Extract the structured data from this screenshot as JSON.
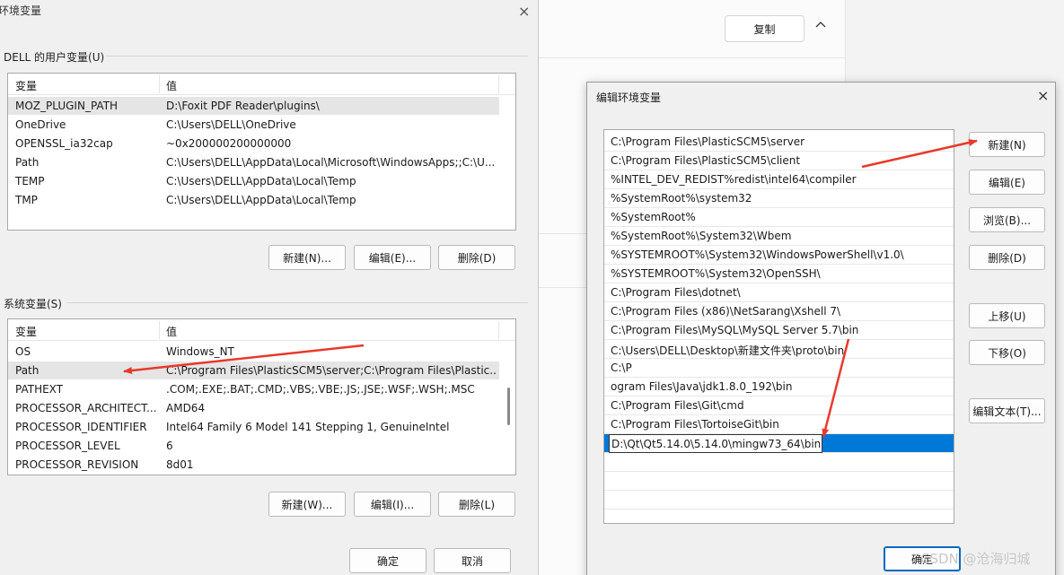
{
  "background": {
    "copy_button": "复制",
    "chevron": "^"
  },
  "env_dialog": {
    "title": "环境变量",
    "close": "×",
    "user_group_label": "DELL 的用户变量(U)",
    "system_group_label": "系统变量(S)",
    "col_variable": "变量",
    "col_value": "值",
    "user_vars": [
      {
        "name": "MOZ_PLUGIN_PATH",
        "value": "D:\\Foxit PDF Reader\\plugins\\"
      },
      {
        "name": "OneDrive",
        "value": "C:\\Users\\DELL\\OneDrive"
      },
      {
        "name": "OPENSSL_ia32cap",
        "value": "~0x200000200000000"
      },
      {
        "name": "Path",
        "value": "C:\\Users\\DELL\\AppData\\Local\\Microsoft\\WindowsApps;;C:\\U..."
      },
      {
        "name": "TEMP",
        "value": "C:\\Users\\DELL\\AppData\\Local\\Temp"
      },
      {
        "name": "TMP",
        "value": "C:\\Users\\DELL\\AppData\\Local\\Temp"
      }
    ],
    "user_buttons": {
      "new": "新建(N)...",
      "edit": "编辑(E)...",
      "delete": "删除(D)"
    },
    "system_vars": [
      {
        "name": "OS",
        "value": "Windows_NT"
      },
      {
        "name": "Path",
        "value": "C:\\Program Files\\PlasticSCM5\\server;C:\\Program Files\\Plastic..."
      },
      {
        "name": "PATHEXT",
        "value": ".COM;.EXE;.BAT;.CMD;.VBS;.VBE;.JS;.JSE;.WSF;.WSH;.MSC"
      },
      {
        "name": "PROCESSOR_ARCHITECT...",
        "value": "AMD64"
      },
      {
        "name": "PROCESSOR_IDENTIFIER",
        "value": "Intel64 Family 6 Model 141 Stepping 1, GenuineIntel"
      },
      {
        "name": "PROCESSOR_LEVEL",
        "value": "6"
      },
      {
        "name": "PROCESSOR_REVISION",
        "value": "8d01"
      }
    ],
    "system_buttons": {
      "new": "新建(W)...",
      "edit": "编辑(I)...",
      "delete": "删除(L)"
    },
    "ok": "确定",
    "cancel": "取消"
  },
  "edit_dialog": {
    "title": "编辑环境变量",
    "close": "×",
    "paths": [
      "C:\\Program Files\\PlasticSCM5\\server",
      "C:\\Program Files\\PlasticSCM5\\client",
      "%INTEL_DEV_REDIST%redist\\intel64\\compiler",
      "%SystemRoot%\\system32",
      "%SystemRoot%",
      "%SystemRoot%\\System32\\Wbem",
      "%SYSTEMROOT%\\System32\\WindowsPowerShell\\v1.0\\",
      "%SYSTEMROOT%\\System32\\OpenSSH\\",
      "C:\\Program Files\\dotnet\\",
      "C:\\Program Files (x86)\\NetSarang\\Xshell 7\\",
      "C:\\Program Files\\MySQL\\MySQL Server 5.7\\bin",
      "C:\\Users\\DELL\\Desktop\\新建文件夹\\proto\\bin",
      "C:\\P",
      "ogram Files\\Java\\jdk1.8.0_192\\bin",
      "C:\\Program Files\\Git\\cmd",
      "C:\\Program Files\\TortoiseGit\\bin"
    ],
    "editing_value": "D:\\Qt\\Qt5.14.0\\5.14.0\\mingw73_64\\bin",
    "buttons": {
      "new": "新建(N)",
      "edit": "编辑(E)",
      "browse": "浏览(B)...",
      "delete": "删除(D)",
      "move_up": "上移(U)",
      "move_down": "下移(O)",
      "edit_text": "编辑文本(T)..."
    },
    "ok": "确定"
  },
  "watermark": "CSDN @沧海归城",
  "annotation_color": "#e8392b",
  "selection_color": "#0078d7"
}
